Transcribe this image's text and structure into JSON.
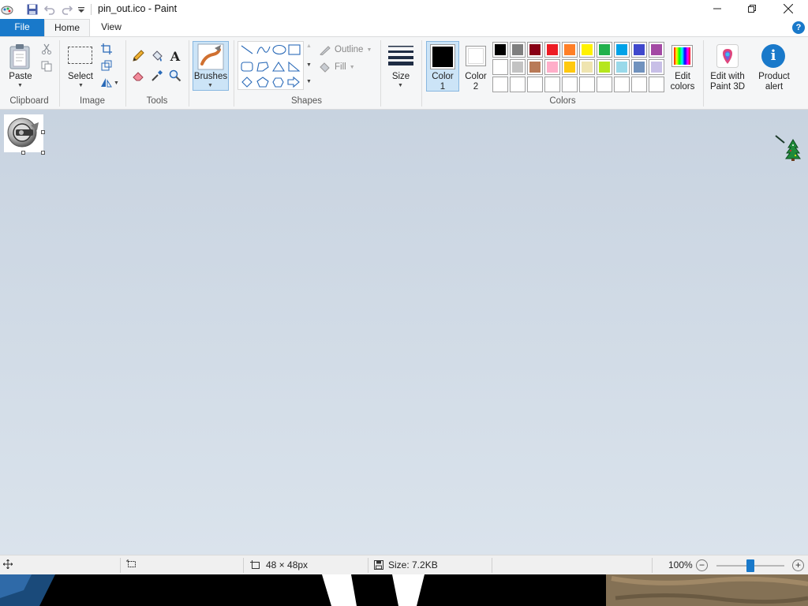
{
  "titlebar": {
    "title": "pin_out.ico - Paint",
    "quick_access": [
      "save-icon",
      "undo-icon",
      "redo-icon",
      "customize-icon"
    ],
    "window_controls": [
      "minimize-icon",
      "maximize-icon",
      "close-icon"
    ]
  },
  "tabs": [
    {
      "label": "File",
      "active": false
    },
    {
      "label": "Home",
      "active": true
    },
    {
      "label": "View",
      "active": false
    }
  ],
  "ribbon": {
    "clipboard": {
      "label": "Clipboard",
      "paste_label": "Paste"
    },
    "image": {
      "label": "Image",
      "select_label": "Select"
    },
    "tools": {
      "label": "Tools"
    },
    "brushes": {
      "label": "Brushes"
    },
    "shapes": {
      "label": "Shapes",
      "outline_label": "Outline",
      "fill_label": "Fill"
    },
    "size": {
      "label": "Size"
    },
    "colors": {
      "label": "Colors",
      "color1_label_line1": "Color",
      "color1_label_line2": "1",
      "color2_label_line1": "Color",
      "color2_label_line2": "2",
      "color1": "#000000",
      "color2": "#ffffff",
      "palette": [
        "#000000",
        "#7f7f7f",
        "#880015",
        "#ed1c24",
        "#ff7f27",
        "#fff200",
        "#22b14c",
        "#00a2e8",
        "#3f48cc",
        "#a349a4",
        "#ffffff",
        "#c3c3c3",
        "#b97a57",
        "#ffaec9",
        "#ffc90e",
        "#efe4b0",
        "#b5e61d",
        "#99d9ea",
        "#7092be",
        "#c8bfe7",
        "#ffffff",
        "#ffffff",
        "#ffffff",
        "#ffffff",
        "#ffffff",
        "#ffffff",
        "#ffffff",
        "#ffffff",
        "#ffffff",
        "#ffffff"
      ],
      "edit_colors_line1": "Edit",
      "edit_colors_line2": "colors"
    },
    "paint3d": {
      "line1": "Edit with",
      "line2": "Paint 3D"
    },
    "product_alert": {
      "line1": "Product",
      "line2": "alert"
    }
  },
  "accent_color": "#1979ca",
  "status": {
    "image_size": "48 × 48px",
    "file_size": "Size: 7.2KB",
    "zoom": "100%"
  }
}
